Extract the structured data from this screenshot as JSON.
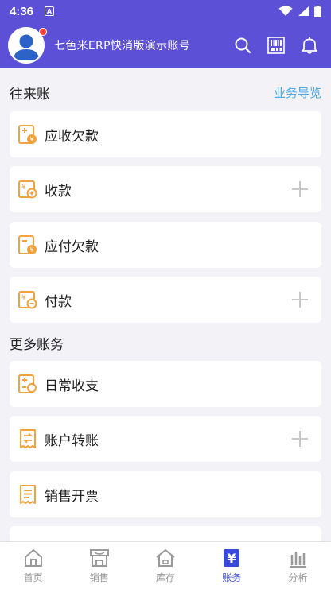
{
  "status": {
    "time": "4:36",
    "notification_letter": "A"
  },
  "header": {
    "title": "七色米ERP快消版演示账号"
  },
  "sections": {
    "contacts": {
      "title": "往来账",
      "link": "业务导览"
    },
    "more": {
      "title": "更多账务"
    }
  },
  "items": {
    "receivable": "应收欠款",
    "receipt": "收款",
    "payable": "应付欠款",
    "payment": "付款",
    "daily": "日常收支",
    "transfer": "账户转账",
    "invoice": "销售开票"
  },
  "tabs": {
    "home": "首页",
    "sales": "销售",
    "stock": "库存",
    "accounts": "账务",
    "analysis": "分析"
  },
  "colors": {
    "primary": "#5b50d6",
    "icon_orange": "#f2a23c",
    "link": "#4fa8e8",
    "tab_active": "#3a4ad8"
  }
}
